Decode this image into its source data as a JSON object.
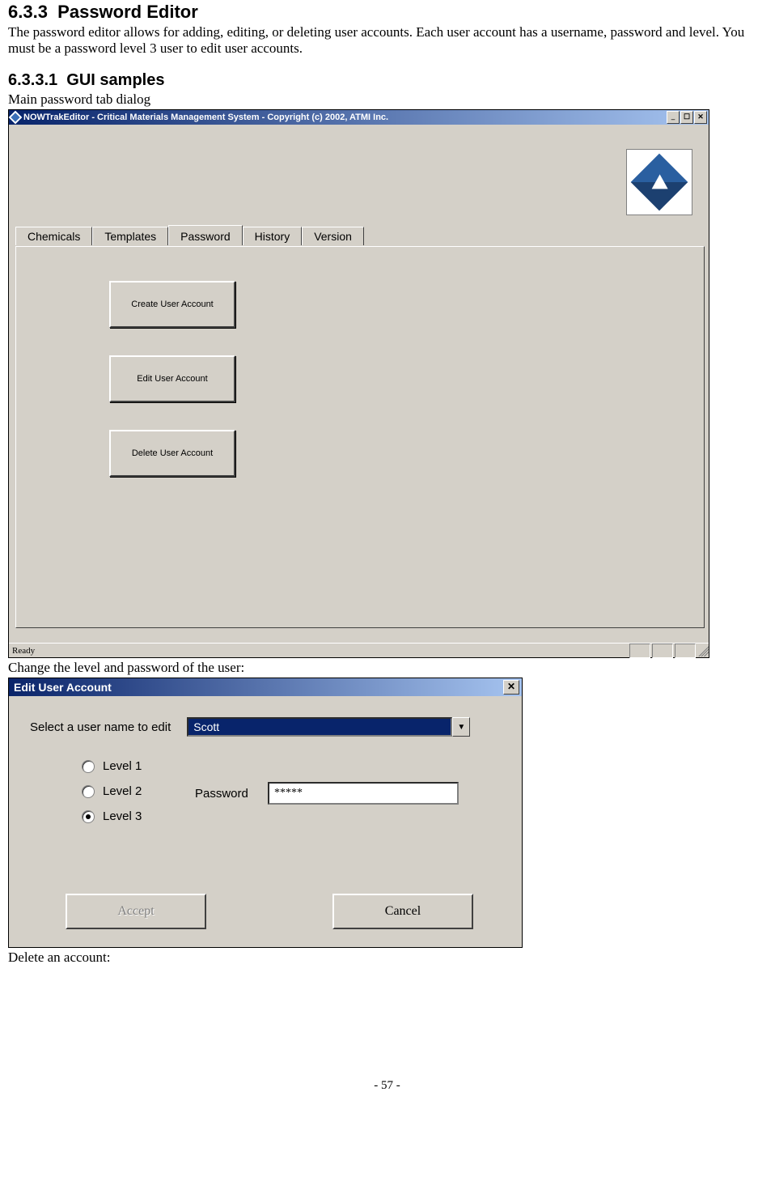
{
  "section": {
    "number": "6.3.3",
    "title": "Password Editor",
    "body": "The password editor allows for adding, editing, or deleting user accounts.  Each user account has a username, password and level.  You must be a password level 3 user to edit user accounts."
  },
  "subsection": {
    "number": "6.3.3.1",
    "title": "GUI samples"
  },
  "caption1": "Main password tab dialog",
  "caption2": "Change the level and password of the user:",
  "caption3": "Delete an account:",
  "mainwin": {
    "title": "NOWTrakEditor - Critical Materials Management System - Copyright (c) 2002, ATMI Inc.",
    "minimize": "_",
    "maximize": "☐",
    "close": "✕",
    "tabs": [
      "Chemicals",
      "Templates",
      "Password",
      "History",
      "Version"
    ],
    "active_tab_index": 2,
    "buttons": {
      "create": "Create User Account",
      "edit": "Edit User Account",
      "delete": "Delete User Account"
    },
    "status": "Ready"
  },
  "editdlg": {
    "title": "Edit User Account",
    "close": "✕",
    "select_label": "Select a user name to edit",
    "selected_user": "Scott",
    "dropdown_arrow": "▼",
    "levels": [
      "Level 1",
      "Level 2",
      "Level 3"
    ],
    "selected_level_index": 2,
    "password_label": "Password",
    "password_value": "*****",
    "accept": "Accept",
    "cancel": "Cancel"
  },
  "page_number": "- 57 -"
}
